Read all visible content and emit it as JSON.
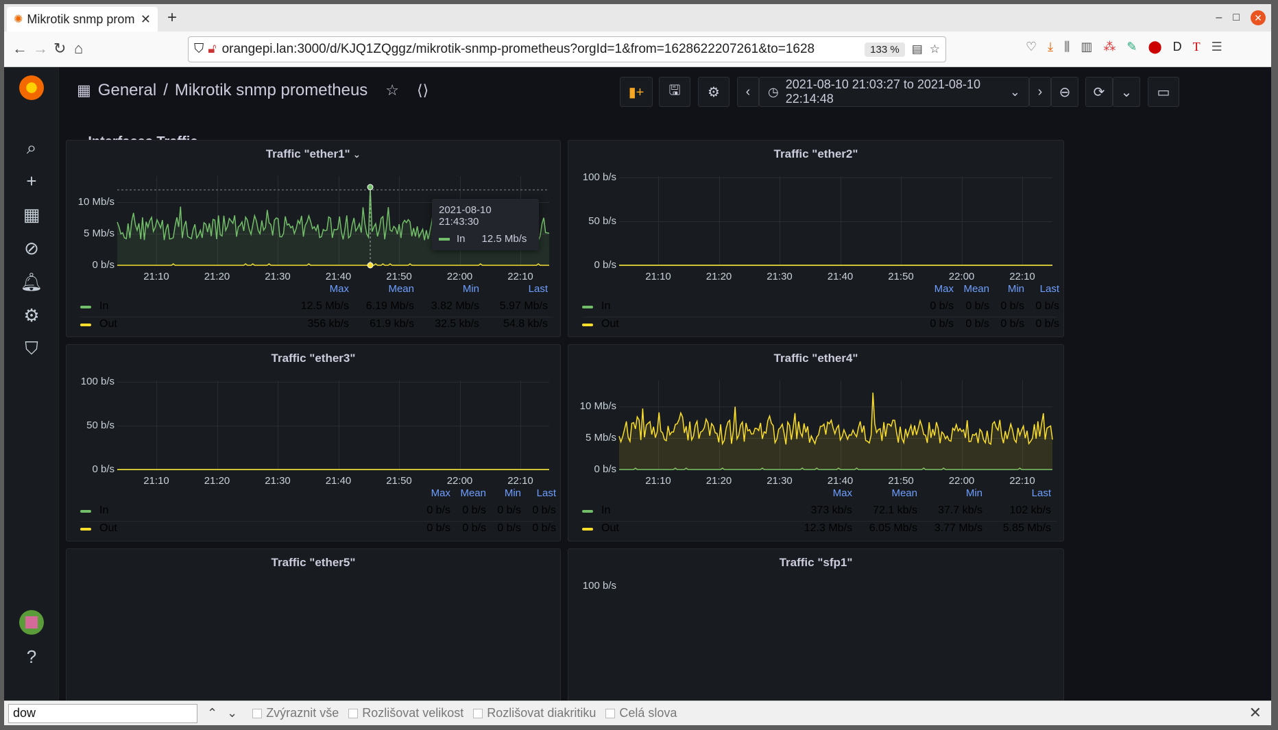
{
  "browser": {
    "tab_title": "Mikrotik snmp prom",
    "url": "orangepi.lan:3000/d/KJQ1ZQggz/mikrotik-snmp-prometheus?orgId=1&from=1628622207261&to=1628",
    "zoom": "133 %"
  },
  "dashboard": {
    "folder": "General",
    "separator": "/",
    "title": "Mikrotik snmp prometheus",
    "time_range": "2021-08-10 21:03:27 to 2021-08-10 22:14:48",
    "row_title": "Interfaces Traffic"
  },
  "legend_headers": [
    "Max",
    "Mean",
    "Min",
    "Last"
  ],
  "x_ticks": [
    "21:10",
    "21:20",
    "21:30",
    "21:40",
    "21:50",
    "22:00",
    "22:10"
  ],
  "panels": [
    {
      "title": "Traffic \"ether1\"",
      "y_ticks": [
        "10 Mb/s",
        "5 Mb/s",
        "0 b/s"
      ],
      "ylim_mbps": [
        0,
        12.5
      ],
      "series": [
        {
          "name": "In",
          "color": "#73bf69",
          "max": "12.5 Mb/s",
          "mean": "6.19 Mb/s",
          "min": "3.82 Mb/s",
          "last": "5.97 Mb/s"
        },
        {
          "name": "Out",
          "color": "#fade2a",
          "max": "356 kb/s",
          "mean": "61.9 kb/s",
          "min": "32.5 kb/s",
          "last": "54.8 kb/s"
        }
      ]
    },
    {
      "title": "Traffic \"ether2\"",
      "y_ticks": [
        "100 b/s",
        "50 b/s",
        "0 b/s"
      ],
      "series": [
        {
          "name": "In",
          "color": "#73bf69",
          "max": "0 b/s",
          "mean": "0 b/s",
          "min": "0 b/s",
          "last": "0 b/s"
        },
        {
          "name": "Out",
          "color": "#fade2a",
          "max": "0 b/s",
          "mean": "0 b/s",
          "min": "0 b/s",
          "last": "0 b/s"
        }
      ]
    },
    {
      "title": "Traffic \"ether3\"",
      "y_ticks": [
        "100 b/s",
        "50 b/s",
        "0 b/s"
      ],
      "series": [
        {
          "name": "In",
          "color": "#73bf69",
          "max": "0 b/s",
          "mean": "0 b/s",
          "min": "0 b/s",
          "last": "0 b/s"
        },
        {
          "name": "Out",
          "color": "#fade2a",
          "max": "0 b/s",
          "mean": "0 b/s",
          "min": "0 b/s",
          "last": "0 b/s"
        }
      ]
    },
    {
      "title": "Traffic \"ether4\"",
      "y_ticks": [
        "10 Mb/s",
        "5 Mb/s",
        "0 b/s"
      ],
      "ylim_mbps": [
        0,
        12.5
      ],
      "series": [
        {
          "name": "In",
          "color": "#73bf69",
          "max": "373 kb/s",
          "mean": "72.1 kb/s",
          "min": "37.7 kb/s",
          "last": "102 kb/s"
        },
        {
          "name": "Out",
          "color": "#fade2a",
          "max": "12.3 Mb/s",
          "mean": "6.05 Mb/s",
          "min": "3.77 Mb/s",
          "last": "5.85 Mb/s"
        }
      ]
    },
    {
      "title": "Traffic \"ether5\""
    },
    {
      "title": "Traffic \"sfp1\"",
      "y_ticks": [
        "100 b/s"
      ]
    }
  ],
  "tooltip": {
    "time": "2021-08-10 21:43:30",
    "series": "In",
    "value": "12.5 Mb/s"
  },
  "findbar": {
    "query": "dow",
    "opt_highlight": "Zvýraznit vše",
    "opt_case": "Rozlišovat velikost",
    "opt_diacritics": "Rozlišovat diakritiku",
    "opt_whole": "Celá slova"
  }
}
